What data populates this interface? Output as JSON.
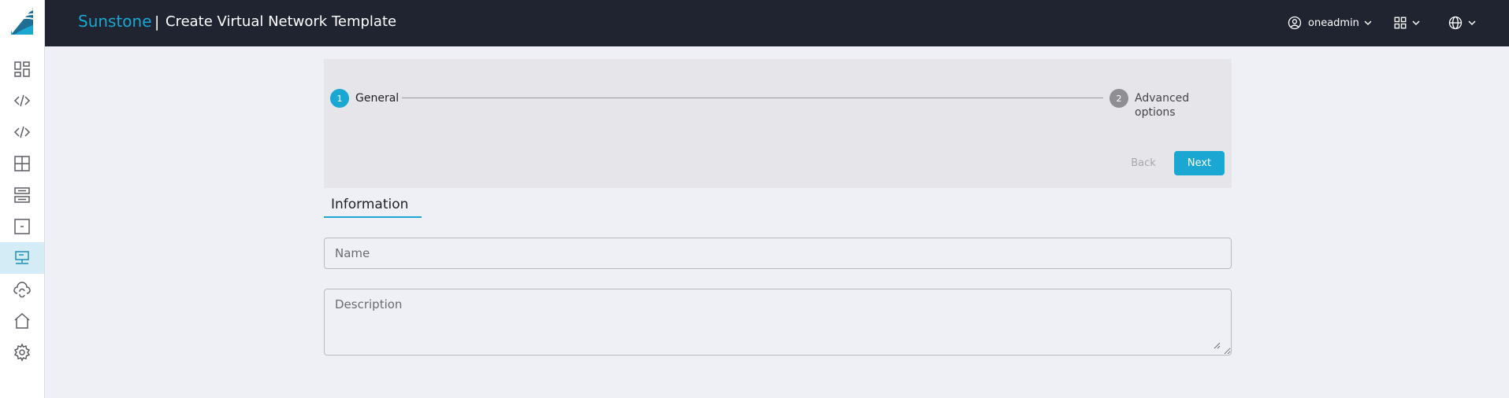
{
  "header": {
    "brand": "Sunstone",
    "separator": "|",
    "title": "Create Virtual Network Template",
    "user": "oneadmin"
  },
  "sidebar": {
    "items": [
      {
        "icon": "dashboard-icon"
      },
      {
        "icon": "code-icon"
      },
      {
        "icon": "code-icon"
      },
      {
        "icon": "grid-icon"
      },
      {
        "icon": "storage-icon"
      },
      {
        "icon": "archive-icon"
      },
      {
        "icon": "network-icon",
        "active": true
      },
      {
        "icon": "cloud-sync-icon"
      },
      {
        "icon": "home-icon"
      },
      {
        "icon": "gear-icon"
      }
    ]
  },
  "stepper": {
    "steps": [
      {
        "number": "1",
        "label": "General",
        "active": true
      },
      {
        "number": "2",
        "label": "Advanced options",
        "active": false
      }
    ],
    "back_label": "Back",
    "next_label": "Next"
  },
  "tabs": [
    {
      "label": "Information",
      "selected": true
    }
  ],
  "form": {
    "name_placeholder": "Name",
    "name_value": "",
    "description_placeholder": "Description",
    "description_value": ""
  },
  "colors": {
    "accent": "#1aa7d2",
    "header_bg": "#1f2430",
    "page_bg": "#eff0f5",
    "stepper_bg": "#e6e6ea",
    "inactive_step": "#8e8e93"
  }
}
